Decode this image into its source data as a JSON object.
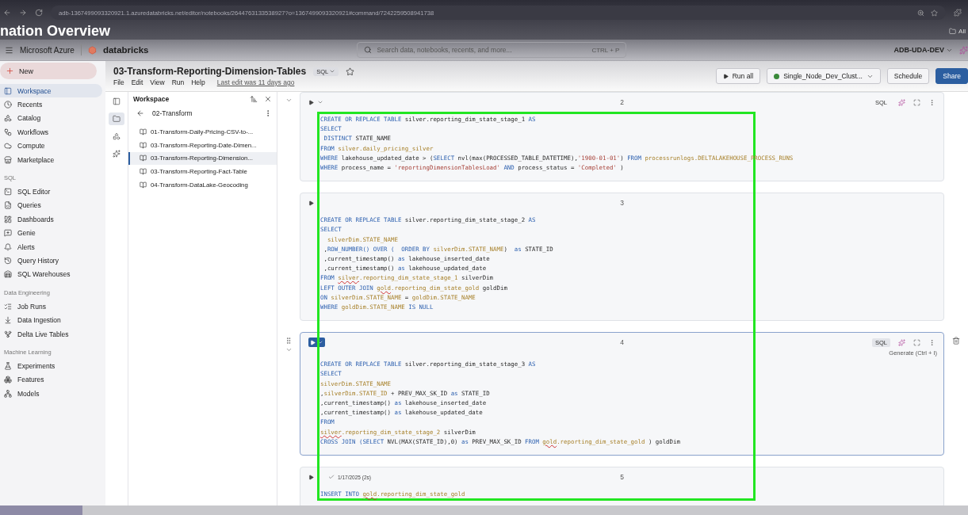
{
  "browser": {
    "url": "adb-1367499093320921.1.azuredatabricks.net/editor/notebooks/2644763133538927?o=1367499093320921#command/7242259508941738",
    "bookmark": "All"
  },
  "video_title": "nation Overview",
  "header": {
    "brand": "Microsoft Azure",
    "logo": "databricks",
    "search": {
      "placeholder": "Search data, notebooks, recents, and more...",
      "shortcut": "CTRL + P"
    },
    "workspace": "ADB-UDA-DEV"
  },
  "sidebar": {
    "new_label": "New",
    "sections": [
      {
        "items": [
          {
            "label": "Workspace",
            "selected": true
          },
          {
            "label": "Recents",
            "selected": false
          },
          {
            "label": "Catalog",
            "selected": false
          },
          {
            "label": "Workflows",
            "selected": false
          },
          {
            "label": "Compute",
            "selected": false
          },
          {
            "label": "Marketplace",
            "selected": false
          }
        ]
      },
      {
        "title": "SQL",
        "items": [
          {
            "label": "SQL Editor",
            "selected": false
          },
          {
            "label": "Queries",
            "selected": false
          },
          {
            "label": "Dashboards",
            "selected": false
          },
          {
            "label": "Genie",
            "selected": false
          },
          {
            "label": "Alerts",
            "selected": false
          },
          {
            "label": "Query History",
            "selected": false
          },
          {
            "label": "SQL Warehouses",
            "selected": false
          }
        ]
      },
      {
        "title": "Data Engineering",
        "items": [
          {
            "label": "Job Runs",
            "selected": false
          },
          {
            "label": "Data Ingestion",
            "selected": false
          },
          {
            "label": "Delta Live Tables",
            "selected": false
          }
        ]
      },
      {
        "title": "Machine Learning",
        "items": [
          {
            "label": "Experiments",
            "selected": false
          },
          {
            "label": "Features",
            "selected": false
          },
          {
            "label": "Models",
            "selected": false
          }
        ]
      }
    ]
  },
  "notebook": {
    "title": "03-Transform-Reporting-Dimension-Tables",
    "language": "SQL",
    "starred": false,
    "menus": [
      "File",
      "Edit",
      "View",
      "Run",
      "Help"
    ],
    "last_edit": "Last edit was 11 days ago",
    "run_all": "Run all",
    "cluster": {
      "name": "Single_Node_Dev_Clust...",
      "running": true
    },
    "schedule": "Schedule",
    "share": "Share"
  },
  "rail_tabs": [
    {
      "selected": false
    },
    {
      "selected": true
    },
    {
      "selected": false
    },
    {
      "selected": false
    }
  ],
  "workspace_panel": {
    "title": "Workspace",
    "folder": "02-Transform",
    "files": [
      {
        "name": "01-Transform-Daily-Pricing-CSV-to-...",
        "selected": false
      },
      {
        "name": "03-Transform-Reporting-Date-Dimen...",
        "selected": false
      },
      {
        "name": "03-Transform-Reporting-Dimension...",
        "selected": true
      },
      {
        "name": "03-Transform-Reporting-Fact-Table",
        "selected": false
      },
      {
        "name": "04-Transform-DataLake-Geocoding",
        "selected": false
      }
    ]
  },
  "cells": [
    {
      "number": "2",
      "selected": false,
      "toolbar": true,
      "language": "SQL",
      "lines": [
        [
          {
            "kind": "kw",
            "t": "CREATE OR REPLACE TABLE "
          },
          {
            "kind": "plain",
            "t": "silver.reporting_dim_state_stage_1 "
          },
          {
            "kind": "kw",
            "t": "AS"
          }
        ],
        [
          {
            "kind": "kw",
            "t": "SELECT"
          }
        ],
        [
          {
            "kind": "kw",
            "t": " DISTINCT"
          },
          {
            "kind": "plain",
            "t": " STATE_NAME"
          }
        ],
        [
          {
            "kind": "kw",
            "t": "FROM "
          },
          {
            "kind": "tbl",
            "t": "silver.daily_pricing_silver"
          }
        ],
        [
          {
            "kind": "kw",
            "t": "WHERE "
          },
          {
            "kind": "plain",
            "t": "lakehouse_updated_date > ("
          },
          {
            "kind": "kw",
            "t": "SELECT "
          },
          {
            "kind": "plain",
            "t": "nvl(max(PROCESSED_TABLE_DATETIME),"
          },
          {
            "kind": "str",
            "t": "'1900-01-01'"
          },
          {
            "kind": "plain",
            "t": ") "
          },
          {
            "kind": "kw",
            "t": "FROM "
          },
          {
            "kind": "tbl",
            "t": "processrunlogs.DELTALAKEHOUSE_PROCESS_RUNS"
          }
        ],
        [
          {
            "kind": "kw",
            "t": "WHERE "
          },
          {
            "kind": "plain",
            "t": "process_name = "
          },
          {
            "kind": "str",
            "t": "'reportingDimensionTablesLoad'"
          },
          {
            "kind": "kw",
            "t": " AND "
          },
          {
            "kind": "plain",
            "t": "process_status = "
          },
          {
            "kind": "str",
            "t": "'Completed'"
          },
          {
            "kind": "plain",
            "t": " )"
          }
        ]
      ]
    },
    {
      "number": "3",
      "selected": false,
      "toolbar": false,
      "lines": [
        [
          {
            "kind": "kw",
            "t": "CREATE OR REPLACE TABLE "
          },
          {
            "kind": "plain",
            "t": "silver.reporting_dim_state_stage_2 "
          },
          {
            "kind": "kw",
            "t": "AS"
          }
        ],
        [
          {
            "kind": "kw",
            "t": "SELECT"
          }
        ],
        [
          {
            "kind": "tbl",
            "t": "  silverDim.STATE_NAME"
          }
        ],
        [
          {
            "kind": "plain",
            "t": " ,"
          },
          {
            "kind": "kw",
            "t": "ROW_NUMBER() OVER (  ORDER BY "
          },
          {
            "kind": "tbl",
            "t": "silverDim.STATE_NAME"
          },
          {
            "kind": "plain",
            "t": ")  "
          },
          {
            "kind": "kw",
            "t": "as "
          },
          {
            "kind": "plain",
            "t": "STATE_ID"
          }
        ],
        [
          {
            "kind": "plain",
            "t": " ,current_timestamp() "
          },
          {
            "kind": "kw",
            "t": "as "
          },
          {
            "kind": "plain",
            "t": "lakehouse_inserted_date"
          }
        ],
        [
          {
            "kind": "plain",
            "t": " ,current_timestamp() "
          },
          {
            "kind": "kw",
            "t": "as "
          },
          {
            "kind": "plain",
            "t": "lakehouse_updated_date"
          }
        ],
        [
          {
            "kind": "kw",
            "t": "FROM "
          },
          {
            "kind": "warn",
            "t": "silver"
          },
          {
            "kind": "tbl",
            "t": ".reporting_dim_state_stage_1 "
          },
          {
            "kind": "plain",
            "t": "silverDim"
          }
        ],
        [
          {
            "kind": "kw",
            "t": "LEFT OUTER JOIN "
          },
          {
            "kind": "warn",
            "t": "gold"
          },
          {
            "kind": "tbl",
            "t": ".reporting_dim_state_gold "
          },
          {
            "kind": "plain",
            "t": "goldDim"
          }
        ],
        [
          {
            "kind": "kw",
            "t": "ON "
          },
          {
            "kind": "tbl",
            "t": "silverDim.STATE_NAME"
          },
          {
            "kind": "plain",
            "t": " = "
          },
          {
            "kind": "tbl",
            "t": "goldDim.STATE_NAME"
          }
        ],
        [
          {
            "kind": "kw",
            "t": "WHERE "
          },
          {
            "kind": "tbl",
            "t": "goldDim.STATE_NAME"
          },
          {
            "kind": "kw",
            "t": " IS NULL"
          }
        ]
      ]
    },
    {
      "number": "4",
      "selected": true,
      "toolbar": true,
      "language": "SQL",
      "hint": "Generate (Ctrl + I)",
      "lines": [
        [
          {
            "kind": "kw",
            "t": "CREATE OR REPLACE TABLE "
          },
          {
            "kind": "plain",
            "t": "silver.reporting_dim_state_stage_3 "
          },
          {
            "kind": "kw",
            "t": "AS"
          }
        ],
        [
          {
            "kind": "kw",
            "t": "SELECT"
          }
        ],
        [
          {
            "kind": "tbl",
            "t": "silverDim.STATE_NAME"
          }
        ],
        [
          {
            "kind": "plain",
            "t": ","
          },
          {
            "kind": "tbl",
            "t": "silverDim.STATE_ID"
          },
          {
            "kind": "plain",
            "t": " + PREV_MAX_SK_ID "
          },
          {
            "kind": "kw",
            "t": "as "
          },
          {
            "kind": "plain",
            "t": "STATE_ID"
          }
        ],
        [
          {
            "kind": "plain",
            "t": ",current_timestamp() "
          },
          {
            "kind": "kw",
            "t": "as "
          },
          {
            "kind": "plain",
            "t": "lakehouse_inserted_date"
          }
        ],
        [
          {
            "kind": "plain",
            "t": ",current_timestamp() "
          },
          {
            "kind": "kw",
            "t": "as "
          },
          {
            "kind": "plain",
            "t": "lakehouse_updated_date"
          }
        ],
        [
          {
            "kind": "kw",
            "t": "FROM"
          }
        ],
        [
          {
            "kind": "warn",
            "t": "silver"
          },
          {
            "kind": "tbl",
            "t": ".reporting_dim_state_stage_2 "
          },
          {
            "kind": "plain",
            "t": "silverDim"
          }
        ],
        [
          {
            "kind": "kw",
            "t": "CROSS JOIN (SELECT "
          },
          {
            "kind": "plain",
            "t": "NVL(MAX(STATE_ID),0) "
          },
          {
            "kind": "kw",
            "t": "as "
          },
          {
            "kind": "plain",
            "t": "PREV_MAX_SK_ID "
          },
          {
            "kind": "kw",
            "t": "FROM "
          },
          {
            "kind": "warn",
            "t": "gold"
          },
          {
            "kind": "tbl",
            "t": ".reporting_dim_state_gold "
          },
          {
            "kind": "plain",
            "t": ") goldDim"
          }
        ]
      ]
    },
    {
      "number": "5",
      "selected": false,
      "toolbar": false,
      "status": "1/17/2025 (2s)",
      "lines": [
        [
          {
            "kind": "kw",
            "t": "INSERT INTO "
          },
          {
            "kind": "warn",
            "t": "gold"
          },
          {
            "kind": "tbl",
            "t": ".reporting_dim_state_gold"
          }
        ]
      ]
    }
  ],
  "video_progress": {
    "level": 0.085
  }
}
